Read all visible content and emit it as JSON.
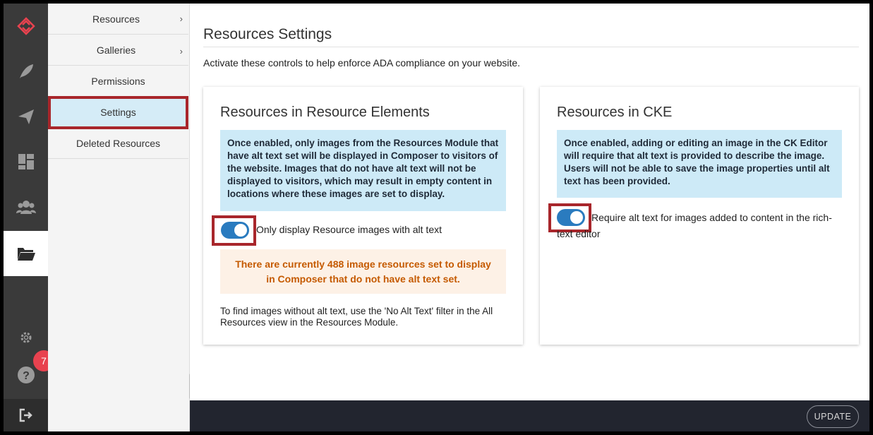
{
  "nav": {
    "icons": [
      "logo-icon",
      "feather-icon",
      "paper-plane-icon",
      "dashboard-icon",
      "users-icon",
      "folder-icon",
      "gear-icon",
      "help-icon",
      "logout-icon"
    ],
    "badge_count": "7",
    "accent_color": "#e8424f"
  },
  "submenu": {
    "items": [
      {
        "label": "Resources"
      },
      {
        "label": "Galleries"
      },
      {
        "label": "Permissions"
      },
      {
        "label": "Settings"
      },
      {
        "label": "Deleted Resources"
      }
    ],
    "chevron": "›"
  },
  "main": {
    "title": "Resources Settings",
    "intro": "Activate these controls to help enforce ADA compliance on your website.",
    "card_left": {
      "title": "Resources in Resource Elements",
      "info": "Once enabled, only images from the Resources Module that have alt text set will be displayed in Composer to visitors of the website. Images that do not have alt text will not be displayed to visitors, which may result in empty content in locations where these images are set to display.",
      "toggle_label": "Only display Resource images with alt text",
      "toggle_on": true,
      "warning": "There are currently 488 image resources set to display in Composer that do not have alt text set.",
      "note": "To find images without alt text, use the 'No Alt Text' filter in the All Resources view in the Resources Module."
    },
    "card_right": {
      "title": "Resources in CKE",
      "info": "Once enabled, adding or editing an image in the CK Editor will require that alt text is provided to describe the image. Users will not be able to save the image properties until alt text has been provided.",
      "toggle_label": "Require alt text for images added to content in the rich-text editor",
      "toggle_on": true
    }
  },
  "footer": {
    "update_label": "UPDATE"
  },
  "colors": {
    "info_bg": "#cdeaf7",
    "warn_bg": "#fdf1e6",
    "warn_text": "#c55a00",
    "toggle": "#2a7bbf",
    "highlight": "#a8262b"
  }
}
